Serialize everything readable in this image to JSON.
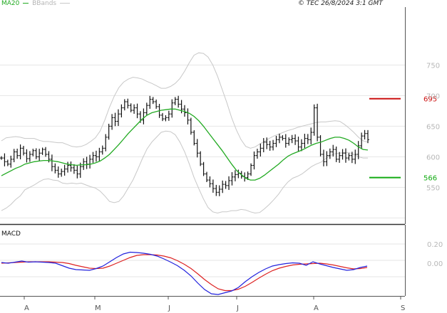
{
  "legend": {
    "ma_label": "MA20",
    "bb_label": "BBands"
  },
  "source": "© TEC 26/8/2024 3:1 GMT",
  "macd_label": "MACD",
  "colors": {
    "ma": "#22aa22",
    "bbands": "#c8c8c8",
    "bars": "#111111",
    "resistance": "#cc1111",
    "support": "#11aa11",
    "macd": "#2222dd",
    "signal": "#dd2222",
    "grid": "#e6e6e6"
  },
  "chart_data": [
    {
      "type": "ohlc",
      "title": "",
      "y_ticks": [
        "750",
        "700",
        "650",
        "600",
        "550"
      ],
      "x_ticks": [
        "A",
        "M",
        "J",
        "J",
        "A",
        "S"
      ],
      "ylim": [
        490,
        790
      ],
      "levels": [
        {
          "name": "resistance",
          "value": 695,
          "label": "695"
        },
        {
          "name": "support",
          "value": 566,
          "label": "566"
        }
      ],
      "close": [
        598,
        592,
        588,
        596,
        608,
        602,
        614,
        606,
        597,
        604,
        610,
        600,
        606,
        612,
        604,
        596,
        584,
        578,
        572,
        576,
        580,
        586,
        582,
        578,
        572,
        584,
        592,
        588,
        596,
        602,
        600,
        608,
        614,
        632,
        650,
        664,
        658,
        670,
        680,
        690,
        684,
        676,
        680,
        670,
        660,
        672,
        684,
        694,
        690,
        682,
        668,
        662,
        664,
        670,
        688,
        694,
        686,
        678,
        672,
        660,
        640,
        622,
        606,
        588,
        572,
        562,
        556,
        548,
        542,
        547,
        555,
        553,
        561,
        567,
        571,
        573,
        568,
        566,
        572,
        586,
        602,
        608,
        614,
        624,
        620,
        616,
        622,
        628,
        632,
        630,
        622,
        628,
        630,
        626,
        616,
        622,
        630,
        628,
        640,
        680,
        632,
        604,
        592,
        602,
        608,
        612,
        596,
        602,
        606,
        598,
        602,
        596,
        604,
        618,
        634,
        638,
        628
      ],
      "ma20": [
        569,
        573,
        577,
        581,
        584,
        588,
        590,
        592,
        593,
        594,
        594,
        593,
        592,
        590,
        588,
        587,
        586,
        587,
        587,
        588,
        590,
        593,
        598,
        604,
        612,
        620,
        629,
        638,
        646,
        654,
        662,
        668,
        672,
        674,
        676,
        677,
        678,
        678,
        676,
        674,
        671,
        666,
        659,
        650,
        640,
        630,
        620,
        610,
        599,
        588,
        578,
        571,
        565,
        562,
        562,
        565,
        570,
        576,
        582,
        588,
        595,
        601,
        605,
        608,
        611,
        615,
        619,
        622,
        624,
        627,
        630,
        632,
        632,
        630,
        627,
        622,
        616,
        612,
        611
      ],
      "bb_upper": [
        626,
        631,
        632,
        633,
        632,
        630,
        630,
        630,
        627,
        625,
        625,
        624,
        623,
        623,
        620,
        617,
        616,
        617,
        620,
        625,
        631,
        642,
        660,
        681,
        699,
        713,
        722,
        727,
        730,
        729,
        727,
        723,
        720,
        716,
        712,
        712,
        715,
        720,
        728,
        740,
        754,
        766,
        770,
        769,
        763,
        750,
        732,
        710,
        688,
        664,
        644,
        628,
        617,
        614,
        616,
        621,
        625,
        630,
        634,
        637,
        640,
        643,
        645,
        648,
        650,
        652,
        654,
        656,
        657,
        657,
        658,
        659,
        658,
        653,
        647,
        640,
        632,
        626,
        624
      ],
      "bb_lower": [
        512,
        516,
        522,
        530,
        536,
        546,
        550,
        554,
        559,
        563,
        564,
        562,
        561,
        557,
        556,
        557,
        556,
        557,
        554,
        551,
        549,
        544,
        536,
        527,
        525,
        527,
        536,
        549,
        562,
        579,
        597,
        613,
        624,
        632,
        640,
        642,
        641,
        636,
        624,
        608,
        588,
        566,
        548,
        531,
        517,
        510,
        508,
        510,
        510,
        512,
        512,
        514,
        513,
        510,
        508,
        509,
        515,
        522,
        530,
        539,
        550,
        559,
        565,
        568,
        572,
        578,
        584,
        588,
        591,
        597,
        602,
        605,
        606,
        607,
        607,
        604,
        600,
        598,
        598
      ]
    },
    {
      "type": "line",
      "title": "MACD",
      "y_ticks": [
        "0.20",
        "0.00"
      ],
      "series": [
        {
          "name": "MACD",
          "values": [
            4,
            2,
            5,
            8,
            5,
            6,
            5,
            4,
            2,
            -5,
            -12,
            -16,
            -17,
            -18,
            -13,
            -6,
            6,
            18,
            28,
            33,
            32,
            30,
            27,
            22,
            14,
            5,
            -5,
            -18,
            -34,
            -54,
            -72,
            -84,
            -86,
            -81,
            -76,
            -66,
            -50,
            -36,
            -24,
            -14,
            -6,
            -2,
            1,
            3,
            2,
            -4,
            6,
            0,
            -5,
            -10,
            -14,
            -18,
            -16,
            -10,
            -6
          ]
        },
        {
          "name": "Signal",
          "values": [
            2,
            3,
            4,
            5,
            6,
            6,
            6,
            6,
            5,
            4,
            1,
            -4,
            -8,
            -12,
            -13,
            -12,
            -6,
            2,
            10,
            18,
            24,
            26,
            26,
            25,
            22,
            17,
            9,
            -1,
            -13,
            -28,
            -44,
            -58,
            -70,
            -75,
            -75,
            -71,
            -63,
            -52,
            -40,
            -29,
            -19,
            -12,
            -7,
            -3,
            -1,
            0,
            1,
            2,
            0,
            -3,
            -7,
            -11,
            -14,
            -13,
            -10
          ]
        }
      ]
    }
  ]
}
